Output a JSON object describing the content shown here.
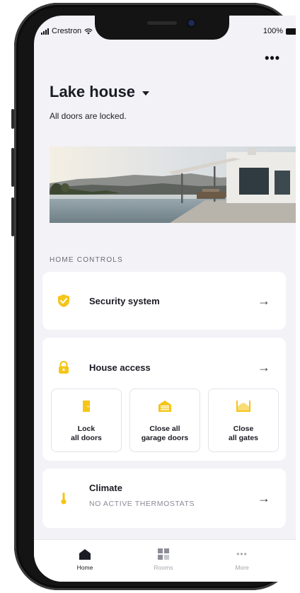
{
  "status_bar": {
    "carrier": "Crestron",
    "battery": "100%"
  },
  "header": {
    "title": "Lake house",
    "subtitle": "All doors are locked."
  },
  "section": {
    "label": "HOME CONTROLS"
  },
  "security": {
    "label": "Security system",
    "icon": "shield-check-icon"
  },
  "access": {
    "label": "House access",
    "icon": "lock-icon",
    "tiles": [
      {
        "label": "Lock\nall doors",
        "icon": "door-icon"
      },
      {
        "label": "Close all\ngarage doors",
        "icon": "garage-icon"
      },
      {
        "label": "Close\nall gates",
        "icon": "gate-icon"
      }
    ]
  },
  "climate": {
    "label": "Climate",
    "status": "NO ACTIVE THERMOSTATS",
    "icon": "thermometer-icon"
  },
  "tabs": [
    {
      "label": "Home",
      "icon": "home-icon",
      "active": true
    },
    {
      "label": "Rooms",
      "icon": "rooms-icon",
      "active": false
    },
    {
      "label": "More",
      "icon": "more-icon",
      "active": false
    }
  ],
  "colors": {
    "accent": "#f5c518",
    "background": "#f2f2f7",
    "card": "#ffffff"
  }
}
